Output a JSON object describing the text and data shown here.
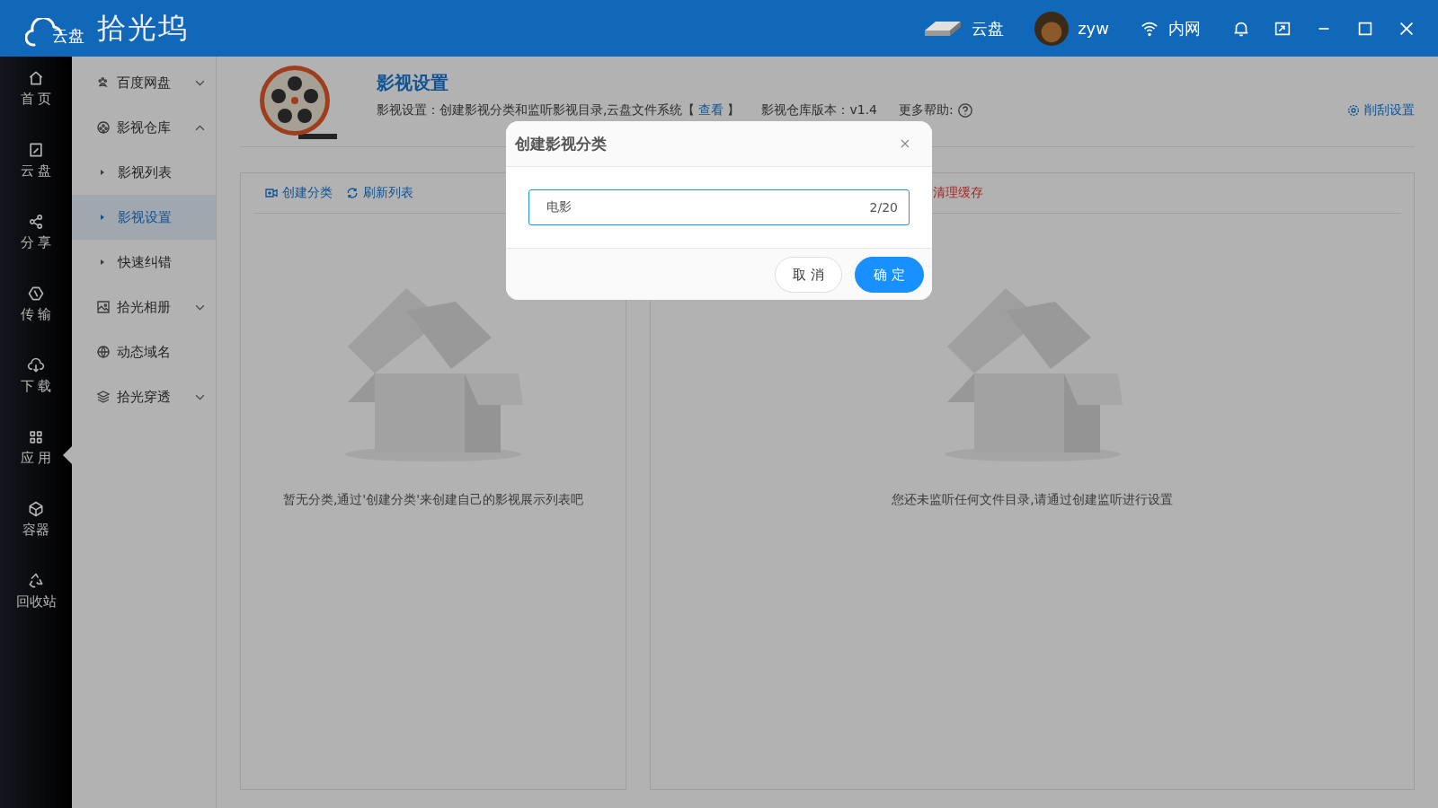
{
  "topbar": {
    "logo_sub": "云盘",
    "logo_title": "拾光坞",
    "disk": "云盘",
    "user": "zyw",
    "network": "内网"
  },
  "nav": [
    {
      "label": "首 页",
      "selected": false
    },
    {
      "label": "云 盘",
      "selected": false
    },
    {
      "label": "分 享",
      "selected": false
    },
    {
      "label": "传 输",
      "selected": false
    },
    {
      "label": "下 载",
      "selected": false
    },
    {
      "label": "应 用",
      "selected": true
    },
    {
      "label": "容器",
      "selected": false
    },
    {
      "label": "回收站",
      "selected": false
    }
  ],
  "submenu": [
    {
      "label": "百度网盘",
      "expanded": false
    },
    {
      "label": "影视仓库",
      "expanded": true,
      "children": [
        {
          "label": "影视列表",
          "selected": false
        },
        {
          "label": "影视设置",
          "selected": true
        },
        {
          "label": "快速纠错",
          "selected": false
        }
      ]
    },
    {
      "label": "拾光相册",
      "expanded": false
    },
    {
      "label": "动态域名"
    },
    {
      "label": "拾光穿透",
      "expanded": false
    }
  ],
  "header": {
    "title": "影视设置",
    "description": "影视设置：创建影视分类和监听影视目录,云盘文件系统【",
    "link": "查看",
    "bracket_close": "】",
    "version": "影视仓库版本：v1.4",
    "help": "更多帮助:",
    "scrape_settings": "削刮设置"
  },
  "panels": [
    {
      "tools": [
        {
          "label": "创建分类",
          "kind": "link"
        },
        {
          "label": "刷新列表",
          "kind": "link"
        }
      ],
      "empty_message": "暂无分类,通过'创建分类'来创建自己的影视展示列表吧"
    },
    {
      "tools": [
        {
          "label": "清理缓存",
          "kind": "danger"
        }
      ],
      "empty_message": "您还未监听任何文件目录,请通过创建监听进行设置"
    }
  ],
  "dialog": {
    "title": "创建影视分类",
    "value": "电影",
    "counter": "2/20",
    "buttons": [
      {
        "label": "取 消",
        "kind": "default"
      },
      {
        "label": "确 定",
        "kind": "primary"
      }
    ]
  }
}
